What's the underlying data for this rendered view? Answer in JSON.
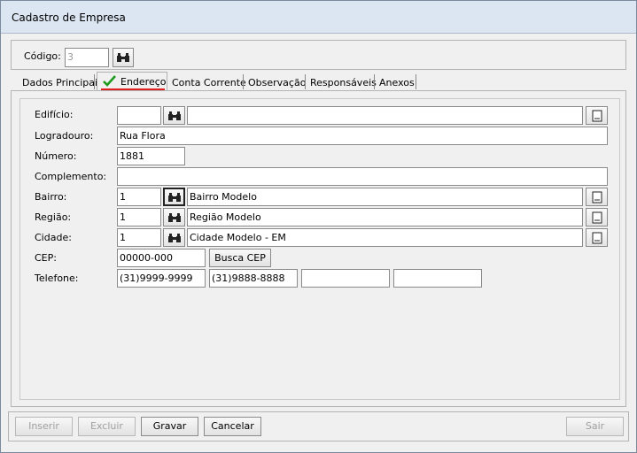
{
  "window": {
    "title": "Cadastro de Empresa"
  },
  "header": {
    "codigo_label": "Código:",
    "codigo_value": "3"
  },
  "tabs": [
    {
      "label": "Dados Principais"
    },
    {
      "label": "Endereço"
    },
    {
      "label": "Conta Corrente"
    },
    {
      "label": "Observação"
    },
    {
      "label": "Responsáveis"
    },
    {
      "label": "Anexos"
    }
  ],
  "form": {
    "edificio": {
      "label": "Edifício:",
      "code": "",
      "name": ""
    },
    "logradouro": {
      "label": "Logradouro:",
      "value": "Rua Flora"
    },
    "numero": {
      "label": "Número:",
      "value": "1881"
    },
    "complemento": {
      "label": "Complemento:",
      "value": ""
    },
    "bairro": {
      "label": "Bairro:",
      "code": "1",
      "name": "Bairro Modelo"
    },
    "regiao": {
      "label": "Região:",
      "code": "1",
      "name": "Região Modelo"
    },
    "cidade": {
      "label": "Cidade:",
      "code": "1",
      "name": "Cidade Modelo - EM"
    },
    "cep": {
      "label": "CEP:",
      "value": "00000-000",
      "button": "Busca CEP"
    },
    "telefone": {
      "label": "Telefone:",
      "values": [
        "(31)9999-9999",
        "(31)9888-8888",
        "",
        ""
      ]
    }
  },
  "footer": {
    "inserir": "Inserir",
    "excluir": "Excluir",
    "gravar": "Gravar",
    "cancelar": "Cancelar",
    "sair": "Sair"
  },
  "colors": {
    "check": "#1e9a1e",
    "active_tab_underline": "#e02020"
  }
}
